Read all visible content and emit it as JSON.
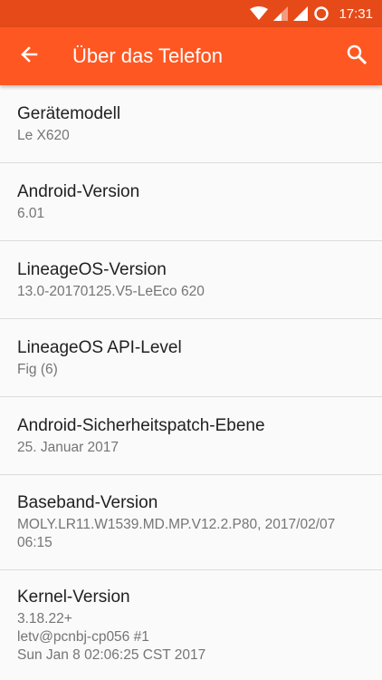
{
  "status_bar": {
    "time": "17:31",
    "icons": [
      "wifi-icon",
      "signal-icon",
      "signal-icon",
      "sync-icon"
    ]
  },
  "toolbar": {
    "title": "Über das Telefon",
    "back_icon": "arrow-left-icon",
    "search_icon": "search-icon"
  },
  "colors": {
    "status_bar": "#e64a19",
    "toolbar": "#ff5722",
    "background": "#fafafa"
  },
  "items": [
    {
      "title": "Gerätemodell",
      "subtitle": "Le X620"
    },
    {
      "title": "Android-Version",
      "subtitle": "6.01"
    },
    {
      "title": "LineageOS-Version",
      "subtitle": "13.0-20170125.V5-LeEco 620"
    },
    {
      "title": "LineageOS API-Level",
      "subtitle": "Fig (6)"
    },
    {
      "title": "Android-Sicherheitspatch-Ebene",
      "subtitle": "25. Januar 2017"
    },
    {
      "title": "Baseband-Version",
      "subtitle": "MOLY.LR11.W1539.MD.MP.V12.2.P80, 2017/02/07\n06:15"
    },
    {
      "title": "Kernel-Version",
      "subtitle": "3.18.22+\nletv@pcnbj-cp056 #1\nSun Jan 8 02:06:25 CST 2017"
    }
  ]
}
